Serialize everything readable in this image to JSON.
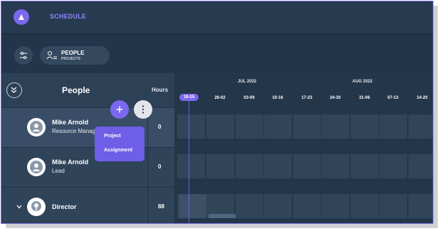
{
  "topbar": {
    "nav_label": "SCHEDULE"
  },
  "view_toggle": {
    "primary": "PEOPLE",
    "secondary": "PROJECTS"
  },
  "people_panel": {
    "title": "People",
    "hours_header": "Hours"
  },
  "rows": [
    {
      "name": "Mike Arnold",
      "role": "Resource Manager",
      "hours": "0"
    },
    {
      "name": "Mike Arnold",
      "role": "Lead",
      "hours": "0"
    },
    {
      "name": "Director",
      "hours": "88"
    }
  ],
  "add_menu": {
    "items": [
      "Project",
      "Assignment"
    ]
  },
  "timeline": {
    "months": [
      "JUL 2022",
      "AUG 2022"
    ],
    "weeks": [
      "19-25",
      "26-02",
      "03-09",
      "10-16",
      "17-23",
      "24-30",
      "31-06",
      "07-13",
      "14-20"
    ],
    "current_week": "19-25"
  },
  "colors": {
    "accent": "#7b68ee",
    "background": "#23364a",
    "panel": "#2c4056"
  },
  "icons": {
    "logo": "app-logo-icon",
    "filter": "sliders-icon",
    "view_toggle": "person-list-icon",
    "collapse": "chevron-double-down-icon",
    "add": "plus-icon",
    "more": "kebab-icon",
    "avatar": "user-icon",
    "director": "role-pin-icon",
    "expand": "chevron-down-icon"
  }
}
